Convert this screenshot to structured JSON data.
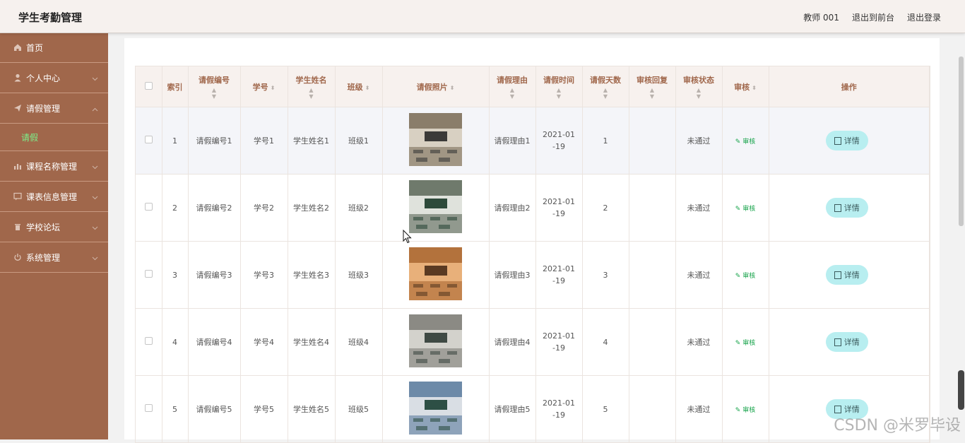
{
  "app": {
    "title": "学生考勤管理",
    "top_links": [
      "教师 001",
      "退出到前台",
      "退出登录"
    ]
  },
  "sidebar": {
    "items": [
      {
        "label": "首页",
        "icon": "home-icon",
        "expandable": false
      },
      {
        "label": "个人中心",
        "icon": "user-icon",
        "expandable": true
      },
      {
        "label": "请假管理",
        "icon": "send-icon",
        "expandable": true,
        "expanded": true
      },
      {
        "label": "课程名称管理",
        "icon": "bar-chart-icon",
        "expandable": true
      },
      {
        "label": "课表信息管理",
        "icon": "message-icon",
        "expandable": true
      },
      {
        "label": "学校论坛",
        "icon": "trash-icon",
        "expandable": true
      },
      {
        "label": "系统管理",
        "icon": "power-icon",
        "expandable": true
      }
    ],
    "sub_item": "请假",
    "active_color": "#7cf08a",
    "bg_color": "#a0674b"
  },
  "table": {
    "headers": {
      "index": "索引",
      "leave_no": "请假编号",
      "student_no": "学号",
      "student_name": "学生姓名",
      "class": "班级",
      "photo": "请假照片",
      "reason": "请假理由",
      "time": "请假时间",
      "days": "请假天数",
      "reply": "审核回复",
      "status": "审核状态",
      "review": "审核",
      "ops": "操作"
    },
    "review_label": "审核",
    "detail_label": "详情",
    "rows": [
      {
        "index": "1",
        "leave_no": "请假编号1",
        "student_no": "学号1",
        "student_name": "学生姓名1",
        "class": "班级1",
        "reason": "请假理由1",
        "time": "2021-01-19",
        "days": "1",
        "reply": "",
        "status": "未通过"
      },
      {
        "index": "2",
        "leave_no": "请假编号2",
        "student_no": "学号2",
        "student_name": "学生姓名2",
        "class": "班级2",
        "reason": "请假理由2",
        "time": "2021-01-19",
        "days": "2",
        "reply": "",
        "status": "未通过"
      },
      {
        "index": "3",
        "leave_no": "请假编号3",
        "student_no": "学号3",
        "student_name": "学生姓名3",
        "class": "班级3",
        "reason": "请假理由3",
        "time": "2021-01-19",
        "days": "3",
        "reply": "",
        "status": "未通过"
      },
      {
        "index": "4",
        "leave_no": "请假编号4",
        "student_no": "学号4",
        "student_name": "学生姓名4",
        "class": "班级4",
        "reason": "请假理由4",
        "time": "2021-01-19",
        "days": "4",
        "reply": "",
        "status": "未通过"
      },
      {
        "index": "5",
        "leave_no": "请假编号5",
        "student_no": "学号5",
        "student_name": "学生姓名5",
        "class": "班级5",
        "reason": "请假理由5",
        "time": "2021-01-19",
        "days": "5",
        "reply": "",
        "status": "未通过"
      }
    ]
  },
  "watermark": "CSDN @米罗毕设"
}
